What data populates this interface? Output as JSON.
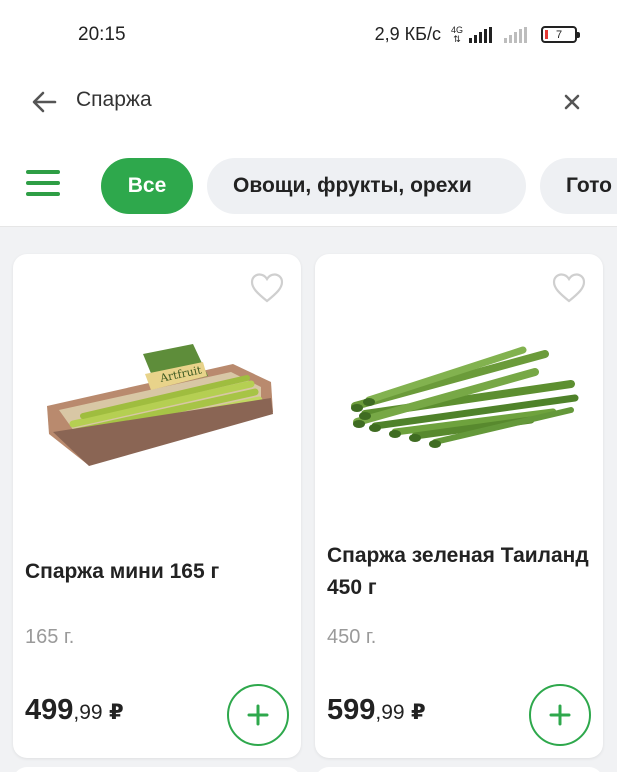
{
  "status_bar": {
    "time": "20:15",
    "speed": "2,9 КБ/с",
    "network_type": "4G",
    "battery": "7"
  },
  "search": {
    "query": "Спаржа"
  },
  "filters": {
    "chips": [
      "Все",
      "Овощи, фрукты, орехи",
      "Гото"
    ]
  },
  "products": [
    {
      "name": "Спаржа мини 165 г",
      "weight": "165 г.",
      "price_int": "499",
      "price_dec": ",99",
      "currency": "₽",
      "image_label": "Artfruit"
    },
    {
      "name": "Спаржа зеленая Таиланд 450 г",
      "weight": "450 г.",
      "price_int": "599",
      "price_dec": ",99",
      "currency": "₽"
    }
  ],
  "colors": {
    "accent": "#2ea84c",
    "chip_bg": "#eef0f3",
    "background": "#f1f2f4"
  }
}
